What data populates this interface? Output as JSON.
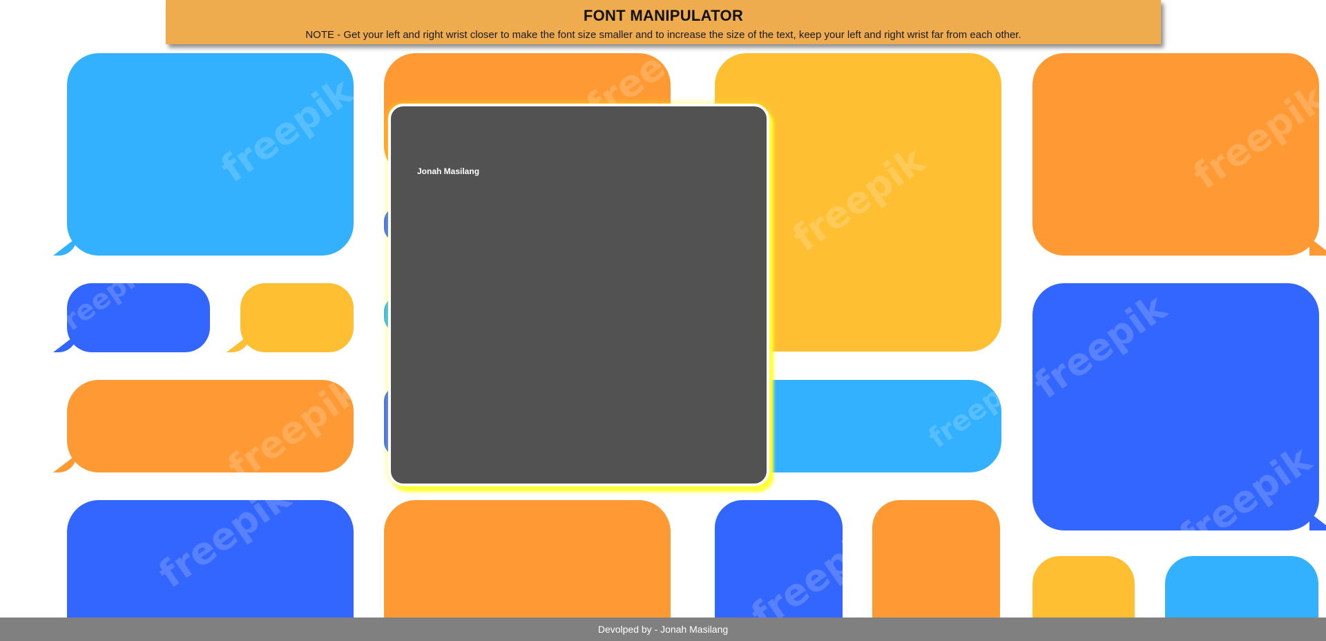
{
  "header": {
    "title": "FONT MANIPULATOR",
    "note": "NOTE - Get your left and right wrist closer to make the font size smaller and to increase the size of the text, keep your left and right wrist far from each other."
  },
  "display": {
    "text": "Jonah Masilang"
  },
  "footer": {
    "text": "Devolped by - Jonah Masilang"
  },
  "background": {
    "watermark": "freepik",
    "colors": {
      "blue": "#3366ff",
      "sky": "#33b1ff",
      "orange": "#ff9933",
      "yellow": "#ffbf33"
    }
  },
  "theme": {
    "header_bg": "#efac4e",
    "panel_bg": "#525252",
    "panel_glow": "#ffff33",
    "footer_bg": "#808080"
  }
}
